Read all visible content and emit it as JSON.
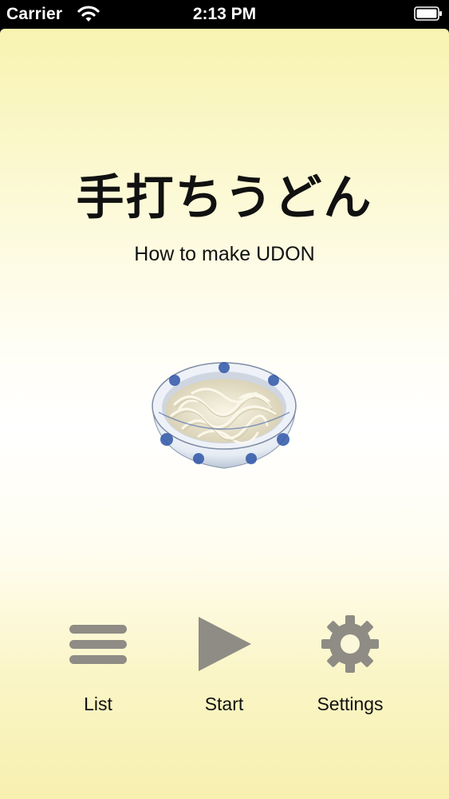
{
  "status_bar": {
    "carrier": "Carrier",
    "time": "2:13 PM"
  },
  "app": {
    "title": "手打ちうどん",
    "subtitle": "How to make UDON"
  },
  "toolbar": {
    "list_label": "List",
    "start_label": "Start",
    "settings_label": "Settings"
  },
  "icons": {
    "list": "list-icon",
    "start": "play-icon",
    "settings": "gear-icon"
  },
  "colors": {
    "icon_gray": "#8e8c84",
    "text": "#111111"
  }
}
